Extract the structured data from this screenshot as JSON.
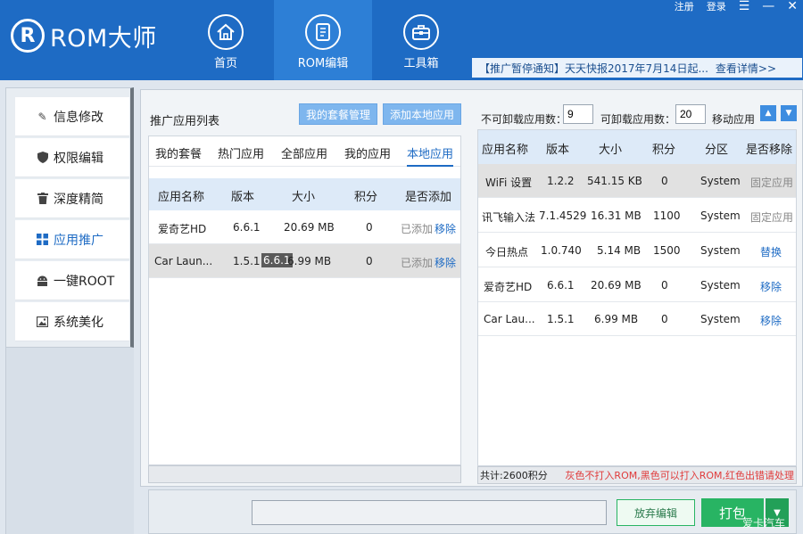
{
  "app": {
    "logo_text": "ROM大师",
    "logo_mark": "R"
  },
  "top_links": {
    "register": "注册",
    "login": "登录"
  },
  "nav": [
    {
      "label": "首页",
      "icon": "home-icon"
    },
    {
      "label": "ROM编辑",
      "icon": "rom-edit-icon",
      "active": true
    },
    {
      "label": "工具箱",
      "icon": "toolbox-icon"
    }
  ],
  "notice": {
    "text": "【推广暂停通知】天天快报2017年7月14日起...",
    "link": "查看详情>>"
  },
  "sidebar": {
    "items": [
      {
        "label": "信息修改",
        "icon": "edit-icon"
      },
      {
        "label": "权限编辑",
        "icon": "shield-icon"
      },
      {
        "label": "深度精简",
        "icon": "trash-icon"
      },
      {
        "label": "应用推广",
        "icon": "apps-grid-icon",
        "active": true
      },
      {
        "label": "一键ROOT",
        "icon": "android-icon"
      },
      {
        "label": "系统美化",
        "icon": "image-icon"
      }
    ]
  },
  "left_panel": {
    "title": "推广应用列表",
    "btn_my_package_manage": "我的套餐管理",
    "btn_add_local": "添加本地应用",
    "tabs": [
      "我的套餐",
      "热门应用",
      "全部应用",
      "我的应用",
      "本地应用"
    ],
    "active_tab": 4,
    "columns": [
      "应用名称",
      "版本",
      "大小",
      "积分",
      "是否添加"
    ],
    "rows": [
      {
        "name": "爱奇艺HD",
        "version": "6.6.1",
        "size": "20.69 MB",
        "points": "0",
        "status": "已添加",
        "action": "移除"
      },
      {
        "name": "Car Laun...",
        "version": "1.5.1",
        "version_tag": "6.6.1",
        "size": "6.99 MB",
        "points": "0",
        "status": "已添加",
        "action": "移除"
      }
    ]
  },
  "right_panel": {
    "non_uninstall_label": "不可卸载应用数：",
    "non_uninstall_value": "9",
    "uninstall_label": "可卸载应用数：",
    "uninstall_value": "20",
    "move_label": "移动应用",
    "columns": [
      "应用名称",
      "版本",
      "大小",
      "积分",
      "分区",
      "是否移除"
    ],
    "rows": [
      {
        "name": "WiFi 设置",
        "version": "1.2.2",
        "size": "541.15 KB",
        "points": "0",
        "partition": "System",
        "action": "固定应用",
        "fixed": true
      },
      {
        "name": "讯飞输入法",
        "version": "7.1.4529",
        "size": "16.31 MB",
        "points": "1100",
        "partition": "System",
        "action": "固定应用",
        "fixed": true
      },
      {
        "name": "今日热点",
        "version": "1.0.740",
        "size": "5.14 MB",
        "points": "1500",
        "partition": "System",
        "action": "替换",
        "fixed": false
      },
      {
        "name": "爱奇艺HD",
        "version": "6.6.1",
        "size": "20.69 MB",
        "points": "0",
        "partition": "System",
        "action": "移除",
        "fixed": false
      },
      {
        "name": "Car Lau...",
        "version": "1.5.1",
        "size": "6.99 MB",
        "points": "0",
        "partition": "System",
        "action": "移除",
        "fixed": false
      }
    ],
    "total": "共计:2600积分",
    "legend": "灰色不打入ROM,黑色可以打入ROM,红色出错请处理"
  },
  "actions": {
    "discard": "放弃编辑",
    "pack": "打包"
  },
  "watermark": "爱卡汽车",
  "colors": {
    "brand_blue": "#1e6bc4",
    "header_active": "#2d7fd6",
    "table_header": "#ddeaf8",
    "pack_green": "#28b463",
    "legend_red": "#e03b3b"
  }
}
